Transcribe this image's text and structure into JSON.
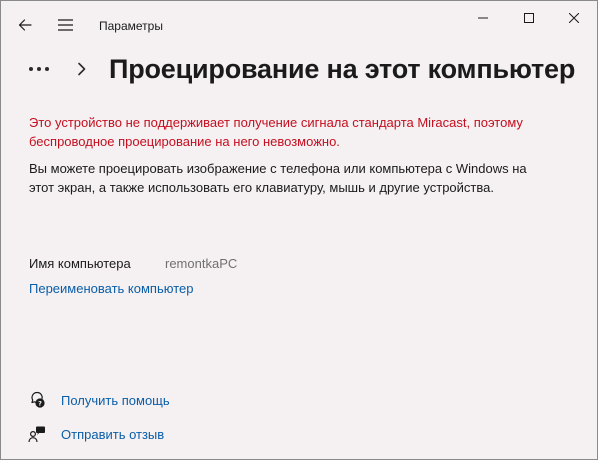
{
  "window": {
    "title": "Параметры"
  },
  "header": {
    "page_title": "Проецирование на этот компьютер"
  },
  "content": {
    "warning_text": "Это устройство не поддерживает получение сигнала стандарта Miracast, поэтому беспроводное проецирование на него невозможно.",
    "description_text": "Вы можете проецировать изображение с телефона или компьютера с Windows на этот экран, а также использовать его клавиатуру, мышь и другие устройства.",
    "pc_name_label": "Имя компьютера",
    "pc_name_value": "remontkaPC",
    "rename_link": "Переименовать компьютер"
  },
  "footer": {
    "help_link": "Получить помощь",
    "feedback_link": "Отправить отзыв"
  },
  "colors": {
    "background": "#f5f0f2",
    "warning": "#c50f1f",
    "link": "#0a5ea8",
    "muted": "#707070"
  },
  "icons": {
    "back": "arrow-left-icon",
    "menu": "hamburger-menu-icon",
    "minimize": "minimize-icon",
    "maximize": "maximize-icon",
    "close": "close-icon",
    "more": "more-dots-icon",
    "chevron": "chevron-right-icon",
    "help": "help-chat-icon",
    "feedback": "feedback-person-icon"
  }
}
